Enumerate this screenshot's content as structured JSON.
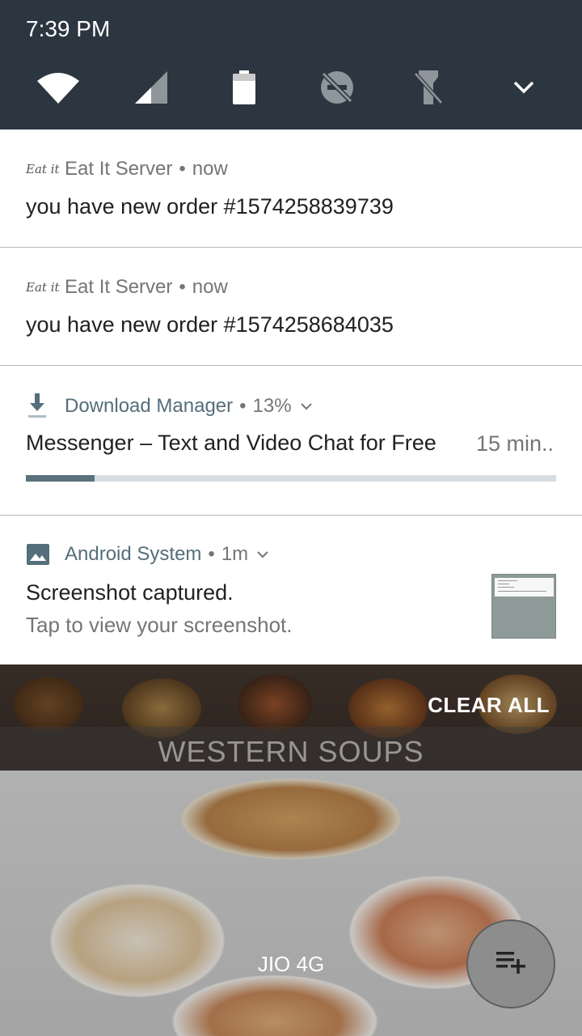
{
  "status_bar": {
    "time": "7:39 PM"
  },
  "quick_settings": {
    "icons": [
      "wifi-icon",
      "cellular-signal-icon",
      "battery-icon",
      "do-not-disturb-off-icon",
      "flashlight-off-icon",
      "expand-chevron-icon"
    ]
  },
  "notifications": [
    {
      "app": "Eat It Server",
      "logo_text": "Eat it",
      "time": "now",
      "title": "you have new order #1574258839739"
    },
    {
      "app": "Eat It Server",
      "logo_text": "Eat it",
      "time": "now",
      "title": "you have new order #1574258684035"
    },
    {
      "app": "Download Manager",
      "meta": "13%",
      "title": "Messenger – Text and Video Chat for Free",
      "time_remaining": "15 min..",
      "progress": 0.13
    },
    {
      "app": "Android System",
      "time": "1m",
      "title": "Screenshot captured.",
      "subtitle": "Tap to view your screenshot."
    }
  ],
  "clear_all_label": "CLEAR ALL",
  "background_app": {
    "category_title": "WESTERN SOUPS"
  },
  "network_label": "JIO 4G",
  "colors": {
    "shade": "#2c3640",
    "accent": "#546e7a",
    "progress": "#5b717d",
    "progress_track": "#d6dde2"
  }
}
